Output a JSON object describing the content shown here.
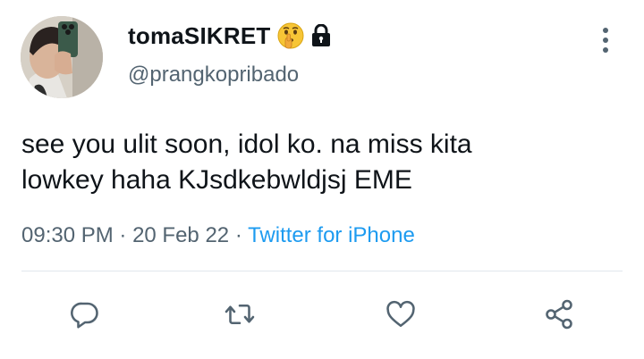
{
  "tweet": {
    "display_name": "tomaSIKRET",
    "handle": "@prangkopribado",
    "text_lines": [
      "see you ulit soon, idol ko. na miss kita",
      "lowkey haha KJsdkebwldjsj EME"
    ],
    "time": "09:30 PM",
    "separator": " · ",
    "date": "20 Feb 22",
    "source": "Twitter for iPhone"
  },
  "icons": {
    "name_emoji": "shushing-face-icon",
    "protected": "lock-icon",
    "more": "more-vertical-icon",
    "actions": [
      "reply-icon",
      "retweet-icon",
      "like-icon",
      "share-icon"
    ]
  },
  "colors": {
    "text": "#0f1419",
    "secondary": "#536471",
    "link": "#1d9bf0",
    "divider": "#e1e8ed"
  }
}
